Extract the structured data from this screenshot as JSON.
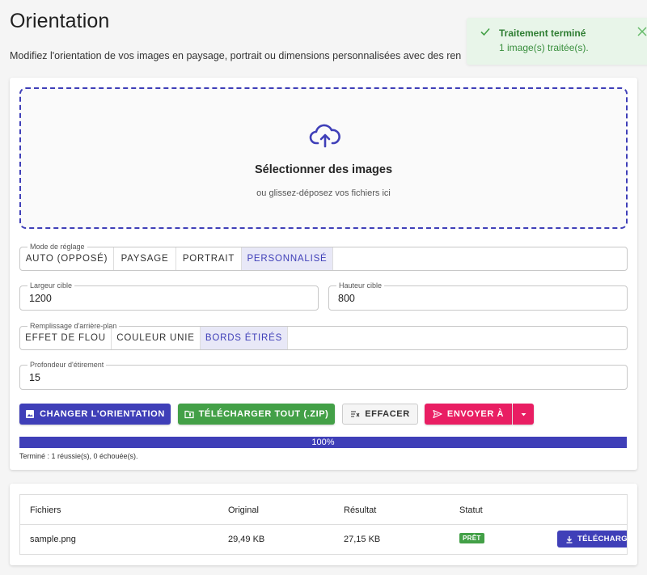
{
  "header": {
    "title": "Orientation",
    "subtitle": "Modifiez l'orientation de vos images en paysage, portrait ou dimensions personnalisées avec des ren"
  },
  "toast": {
    "title": "Traitement terminé",
    "message": "1 image(s) traitée(s).",
    "color": "#2e7d32"
  },
  "dropzone": {
    "title": "Sélectionner des images",
    "subtitle": "ou glissez-déposez vos fichiers ici"
  },
  "mode": {
    "legend": "Mode de réglage",
    "options": [
      "AUTO (OPPOSÉ)",
      "PAYSAGE",
      "PORTRAIT",
      "PERSONNALISÉ"
    ],
    "selected": "PERSONNALISÉ"
  },
  "width_field": {
    "label": "Largeur cible",
    "value": "1200"
  },
  "height_field": {
    "label": "Hauteur cible",
    "value": "800"
  },
  "fill": {
    "legend": "Remplissage d'arrière-plan",
    "options": [
      "EFFET DE FLOU",
      "COULEUR UNIE",
      "BORDS ÉTIRÉS"
    ],
    "selected": "BORDS ÉTIRÉS"
  },
  "depth_field": {
    "label": "Profondeur d'étirement",
    "value": "15"
  },
  "actions": {
    "change": "CHANGER L'ORIENTATION",
    "download_all": "TÉLÉCHARGER TOUT (.ZIP)",
    "clear": "EFFACER",
    "send": "ENVOYER À"
  },
  "progress": {
    "value": 1.0,
    "label": "100%",
    "status": "Terminé : 1 réussie(s), 0 échouée(s)."
  },
  "table": {
    "headers": [
      "Fichiers",
      "Original",
      "Résultat",
      "Statut"
    ],
    "rows": [
      {
        "file": "sample.png",
        "original": "29,49 KB",
        "result": "27,15 KB",
        "status": "PRÊT",
        "action": "TÉLÉCHARGER"
      }
    ]
  },
  "colors": {
    "primary": "#3f3fb8",
    "success": "#43a047",
    "pink": "#e91e63",
    "toast_bg": "#e8f5e9"
  }
}
